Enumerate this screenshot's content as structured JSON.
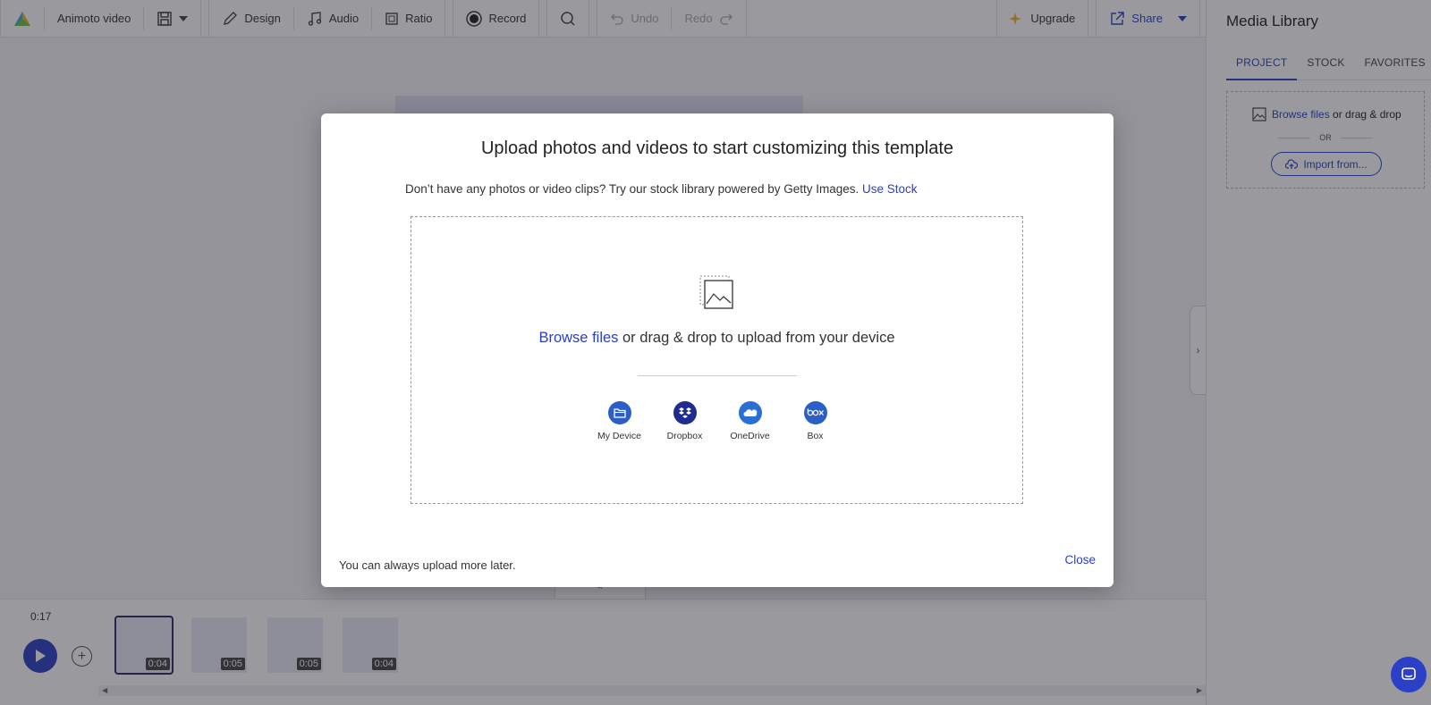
{
  "toolbar": {
    "app_name": "Animoto video",
    "design": "Design",
    "audio": "Audio",
    "ratio": "Ratio",
    "record": "Record",
    "undo": "Undo",
    "redo": "Redo",
    "upgrade": "Upgrade",
    "share": "Share"
  },
  "timeline": {
    "time": "0:17",
    "clips": [
      {
        "duration": "0:04",
        "selected": true
      },
      {
        "duration": "0:05",
        "selected": false
      },
      {
        "duration": "0:05",
        "selected": false
      },
      {
        "duration": "0:04",
        "selected": false
      }
    ]
  },
  "media_library": {
    "title": "Media Library",
    "tabs": [
      "PROJECT",
      "STOCK",
      "FAVORITES"
    ],
    "active_tab": "PROJECT",
    "browse_link": "Browse files",
    "browse_rest": " or drag & drop",
    "or": "OR",
    "import": "Import from..."
  },
  "modal": {
    "title": "Upload photos and videos to start customizing this template",
    "subtitle": "Don’t have any photos or video clips? Try our stock library powered by Getty Images.",
    "use_stock": "Use Stock",
    "browse_link": "Browse files",
    "browse_rest": " or drag & drop to upload from your device",
    "sources": [
      {
        "label": "My Device",
        "icon": "folder-icon"
      },
      {
        "label": "Dropbox",
        "icon": "dropbox-icon"
      },
      {
        "label": "OneDrive",
        "icon": "onedrive-icon"
      },
      {
        "label": "Box",
        "icon": "box-icon"
      }
    ],
    "footer": "You can always upload more later.",
    "close": "Close"
  },
  "colors": {
    "accent": "#2b3fc7",
    "overlay": "rgba(30,30,40,0.45)"
  }
}
